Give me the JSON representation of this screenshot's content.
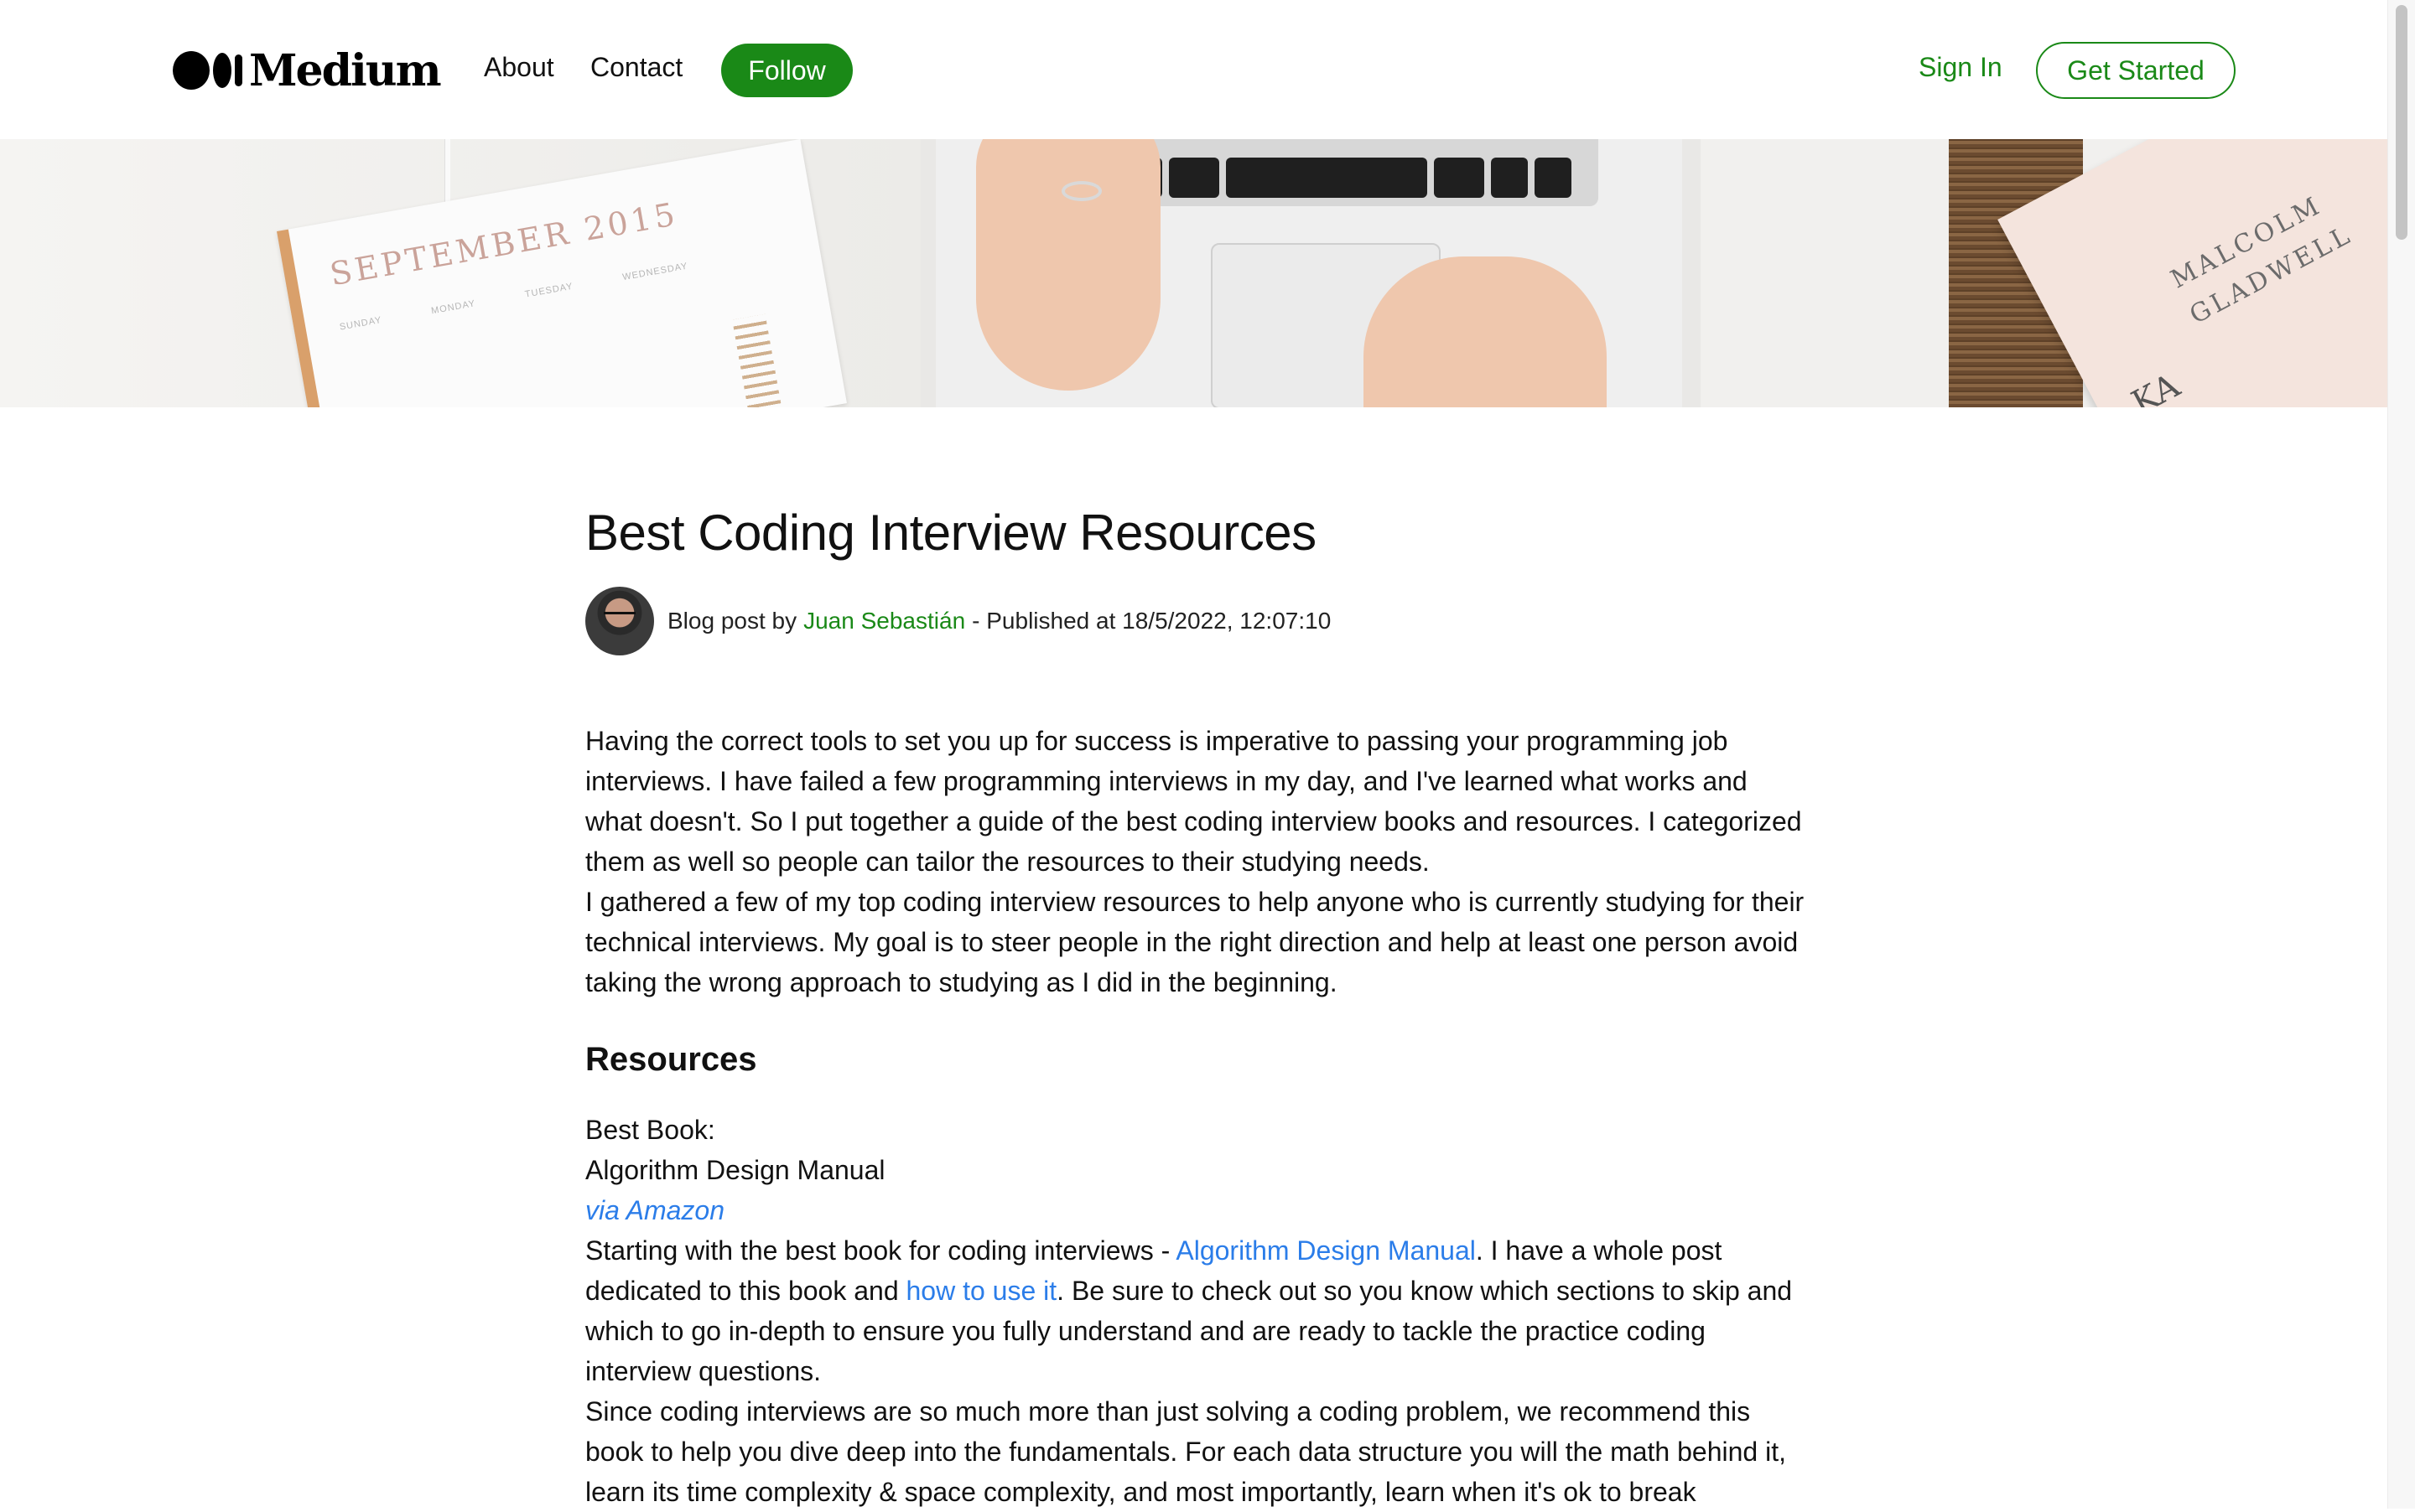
{
  "header": {
    "logo_text": "Medium",
    "nav": {
      "about": "About",
      "contact": "Contact"
    },
    "follow_label": "Follow",
    "sign_in_label": "Sign In",
    "get_started_label": "Get Started"
  },
  "hero": {
    "planner_month": "SEPTEMBER 2015",
    "planner_days": [
      "SUNDAY",
      "MONDAY",
      "TUESDAY",
      "WEDNESDAY"
    ],
    "book_author_line1": "MALCOLM",
    "book_author_line2": "GLADWELL",
    "book_title_fragment": "KA"
  },
  "article": {
    "title": "Best Coding Interview Resources",
    "byline": {
      "prefix": "Blog post by",
      "author": "Juan Sebastián",
      "published": "- Published at 18/5/2022, 12:07:10"
    },
    "intro": [
      "Having the correct tools to set you up for success is imperative to passing your programming job interviews. I have failed a few programming interviews in my day, and I've learned what works and what doesn't. So I put together a guide of the best coding interview books and resources. I categorized them as well so people can tailor the resources to their studying needs.",
      "I gathered a few of my top coding interview resources to help anyone who is currently studying for their technical interviews. My goal is to steer people in the right direction and help at least one person avoid taking the wrong approach to studying as I did in the beginning."
    ],
    "resources_heading": "Resources",
    "best_book_label": "Best Book:",
    "best_book_name": "Algorithm Design Manual",
    "via_amazon": "via Amazon",
    "p1_before": "Starting with the best book for coding interviews - ",
    "p1_link1": "Algorithm Design Manual",
    "p1_mid": ". I have a whole post dedicated to this book and ",
    "p1_link2": "how to use it",
    "p1_after": ". Be sure to check out so you know which sections to skip and which to go in-depth to ensure you fully understand and are ready to tackle the practice coding interview questions.",
    "p2": "Since coding interviews are so much more than just solving a coding problem, we recommend this book to help you dive deep into the fundamentals. For each data structure you will the math behind it, learn its time complexity & space complexity, and most importantly, learn when it's ok to break"
  },
  "colors": {
    "brand_green": "#1a8917",
    "link_blue": "#2b7de9",
    "text": "#111111"
  },
  "icons": [
    "medium-logo-icon",
    "avatar"
  ]
}
